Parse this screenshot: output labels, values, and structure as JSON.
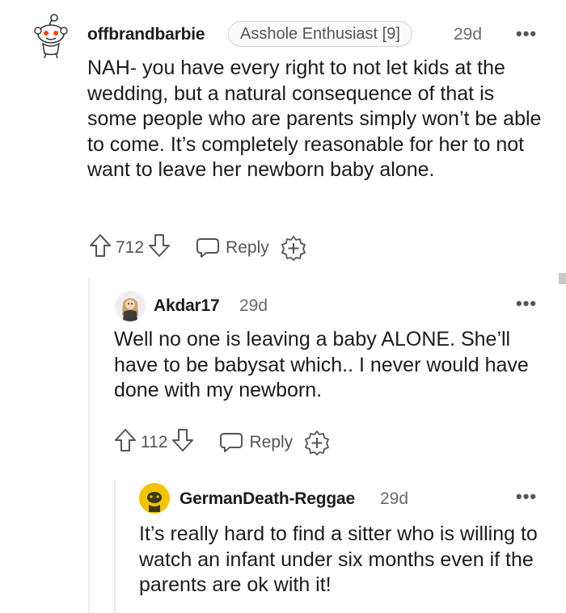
{
  "comments": [
    {
      "username": "offbrandbarbie",
      "flair": "Asshole Enthusiast [9]",
      "time": "29d",
      "more": "•••",
      "body": "NAH- you have every right to not let kids at the wedding, but a natural consequence of that is some people who are parents simply won’t be able to come. It’s completely reasonable for her to not want to leave her newborn baby alone.",
      "votes": "712",
      "reply_label": "Reply"
    },
    {
      "username": "Akdar17",
      "time": "29d",
      "more": "•••",
      "body": "Well no one is leaving a baby ALONE. She’ll have to be babysat which.. I never would have done with my newborn.",
      "votes": "112",
      "reply_label": "Reply"
    },
    {
      "username": "GermanDeath-Reggae",
      "time": "29d",
      "more": "•••",
      "body": "It’s really hard to find a sitter who is willing to watch an infant under six months even if the parents are ok with it!"
    }
  ],
  "colors": {
    "text": "#1c1c1c",
    "meta": "#6a6a6a",
    "icon": "#555555",
    "thread_line": "#ebebeb",
    "avatar_yellow": "#f5c400"
  }
}
